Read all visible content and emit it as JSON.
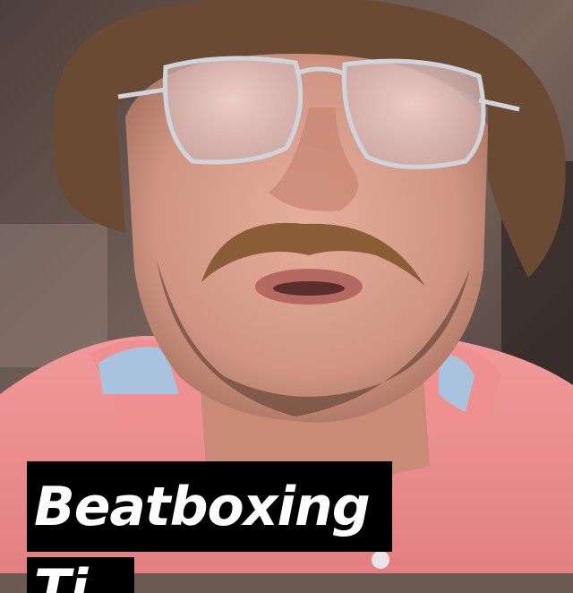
{
  "caption": {
    "line1": "Beatboxing",
    "line2": "Ti"
  },
  "colors": {
    "shirt": "#e98a8c",
    "collar_lining": "#a9c2dd",
    "hair": "#6b4a33",
    "skin": "#d49a88",
    "background": "#5a4a45",
    "caption_bg": "#000000",
    "caption_text": "#ffffff"
  },
  "effects": [
    "aviator-glasses-filter",
    "mustache-filter"
  ]
}
